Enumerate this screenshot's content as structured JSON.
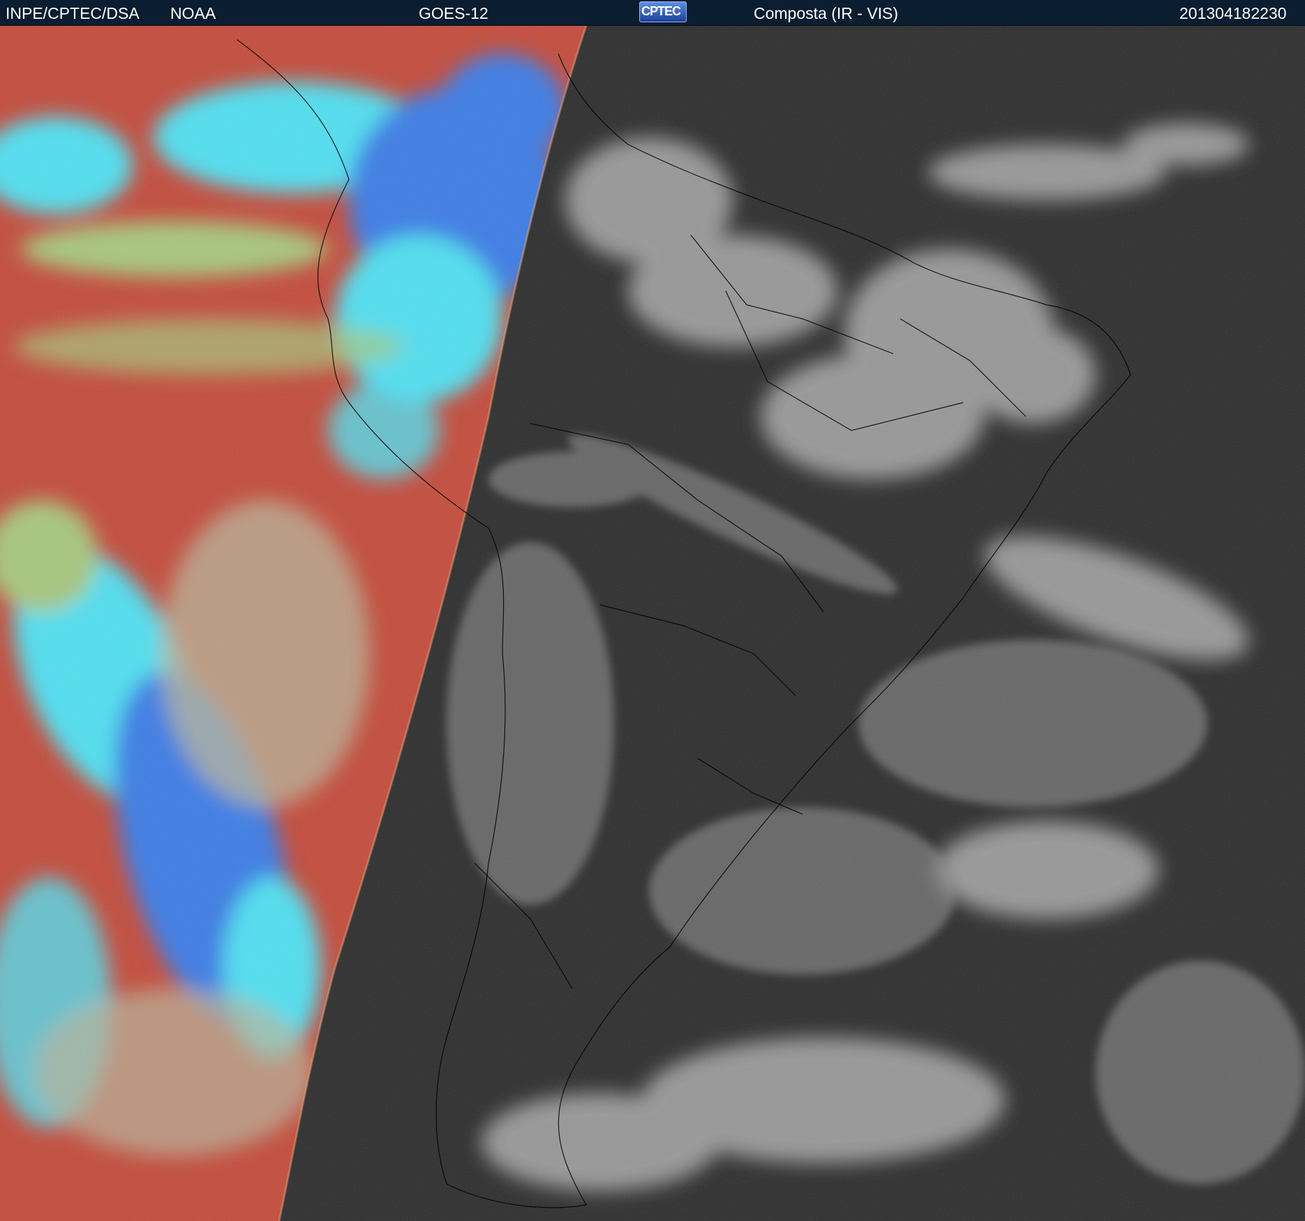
{
  "header": {
    "agency": "INPE/CPTEC/DSA",
    "partner": "NOAA",
    "satellite": "GOES-12",
    "logo_text": "CPTEC",
    "product": "Composta (IR - VIS)",
    "timestamp": "201304182230"
  },
  "imagery": {
    "night_side": "false-color infrared",
    "day_side": "grayscale visible",
    "colors": {
      "ir_ocean_red": "#c44a3a",
      "ir_cloud_cyan": "#4fe0f2",
      "ir_cloud_blue": "#3a7be6",
      "ir_transition_green": "#a7c77d",
      "vis_background": "#2b2b2b",
      "vis_cloud": "#cfcfcf",
      "border_line": "#000000"
    }
  }
}
